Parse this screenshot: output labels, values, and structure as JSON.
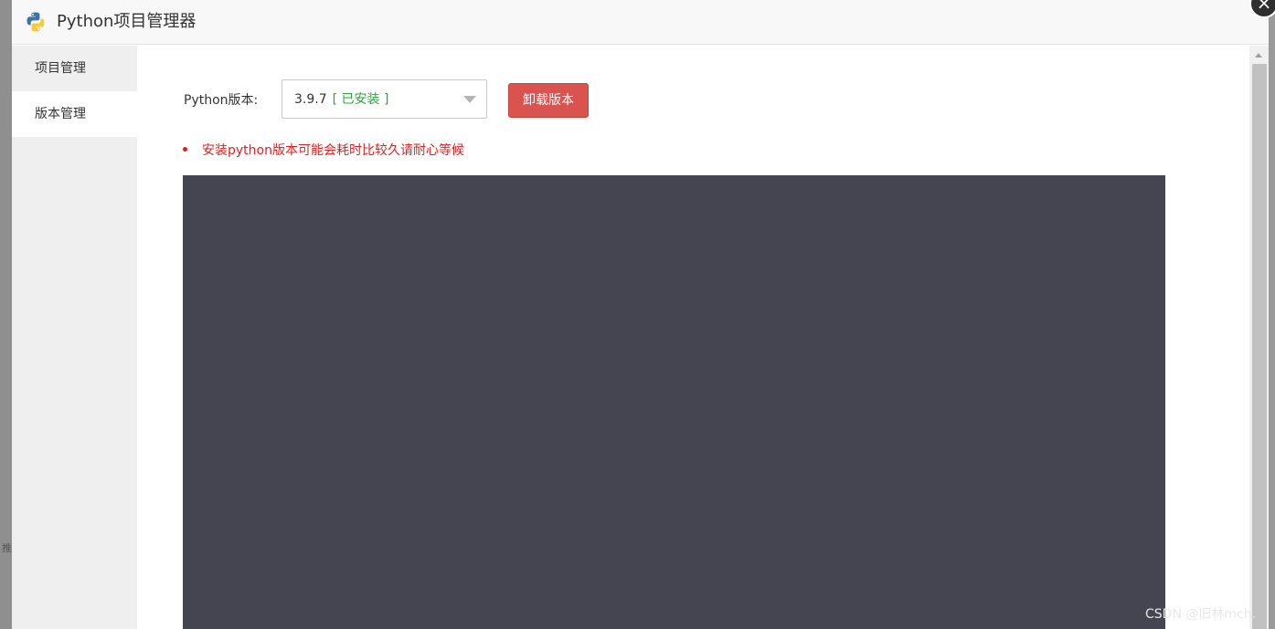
{
  "window": {
    "title": "Python项目管理器"
  },
  "sidebar": {
    "items": [
      {
        "label": "项目管理"
      },
      {
        "label": "版本管理"
      }
    ]
  },
  "main": {
    "version_label": "Python版本:",
    "version_select": {
      "value": "3.9.7",
      "status": "[ 已安装 ]"
    },
    "uninstall_button": "卸载版本",
    "notice": "安装python版本可能会耗时比较久请耐心等候"
  },
  "background": {
    "glyph": "推"
  },
  "watermark": "CSDN @旧林mch.",
  "colors": {
    "danger": "#d9534f",
    "installed_status": "#2aa53a",
    "notice_text": "#e02020",
    "console_bg": "#454451",
    "python_blue": "#3d74a8",
    "python_yellow": "#f7c93b"
  },
  "icons": {
    "logo": "python-logo-icon",
    "close": "close-icon",
    "dropdown": "chevron-down-icon"
  }
}
